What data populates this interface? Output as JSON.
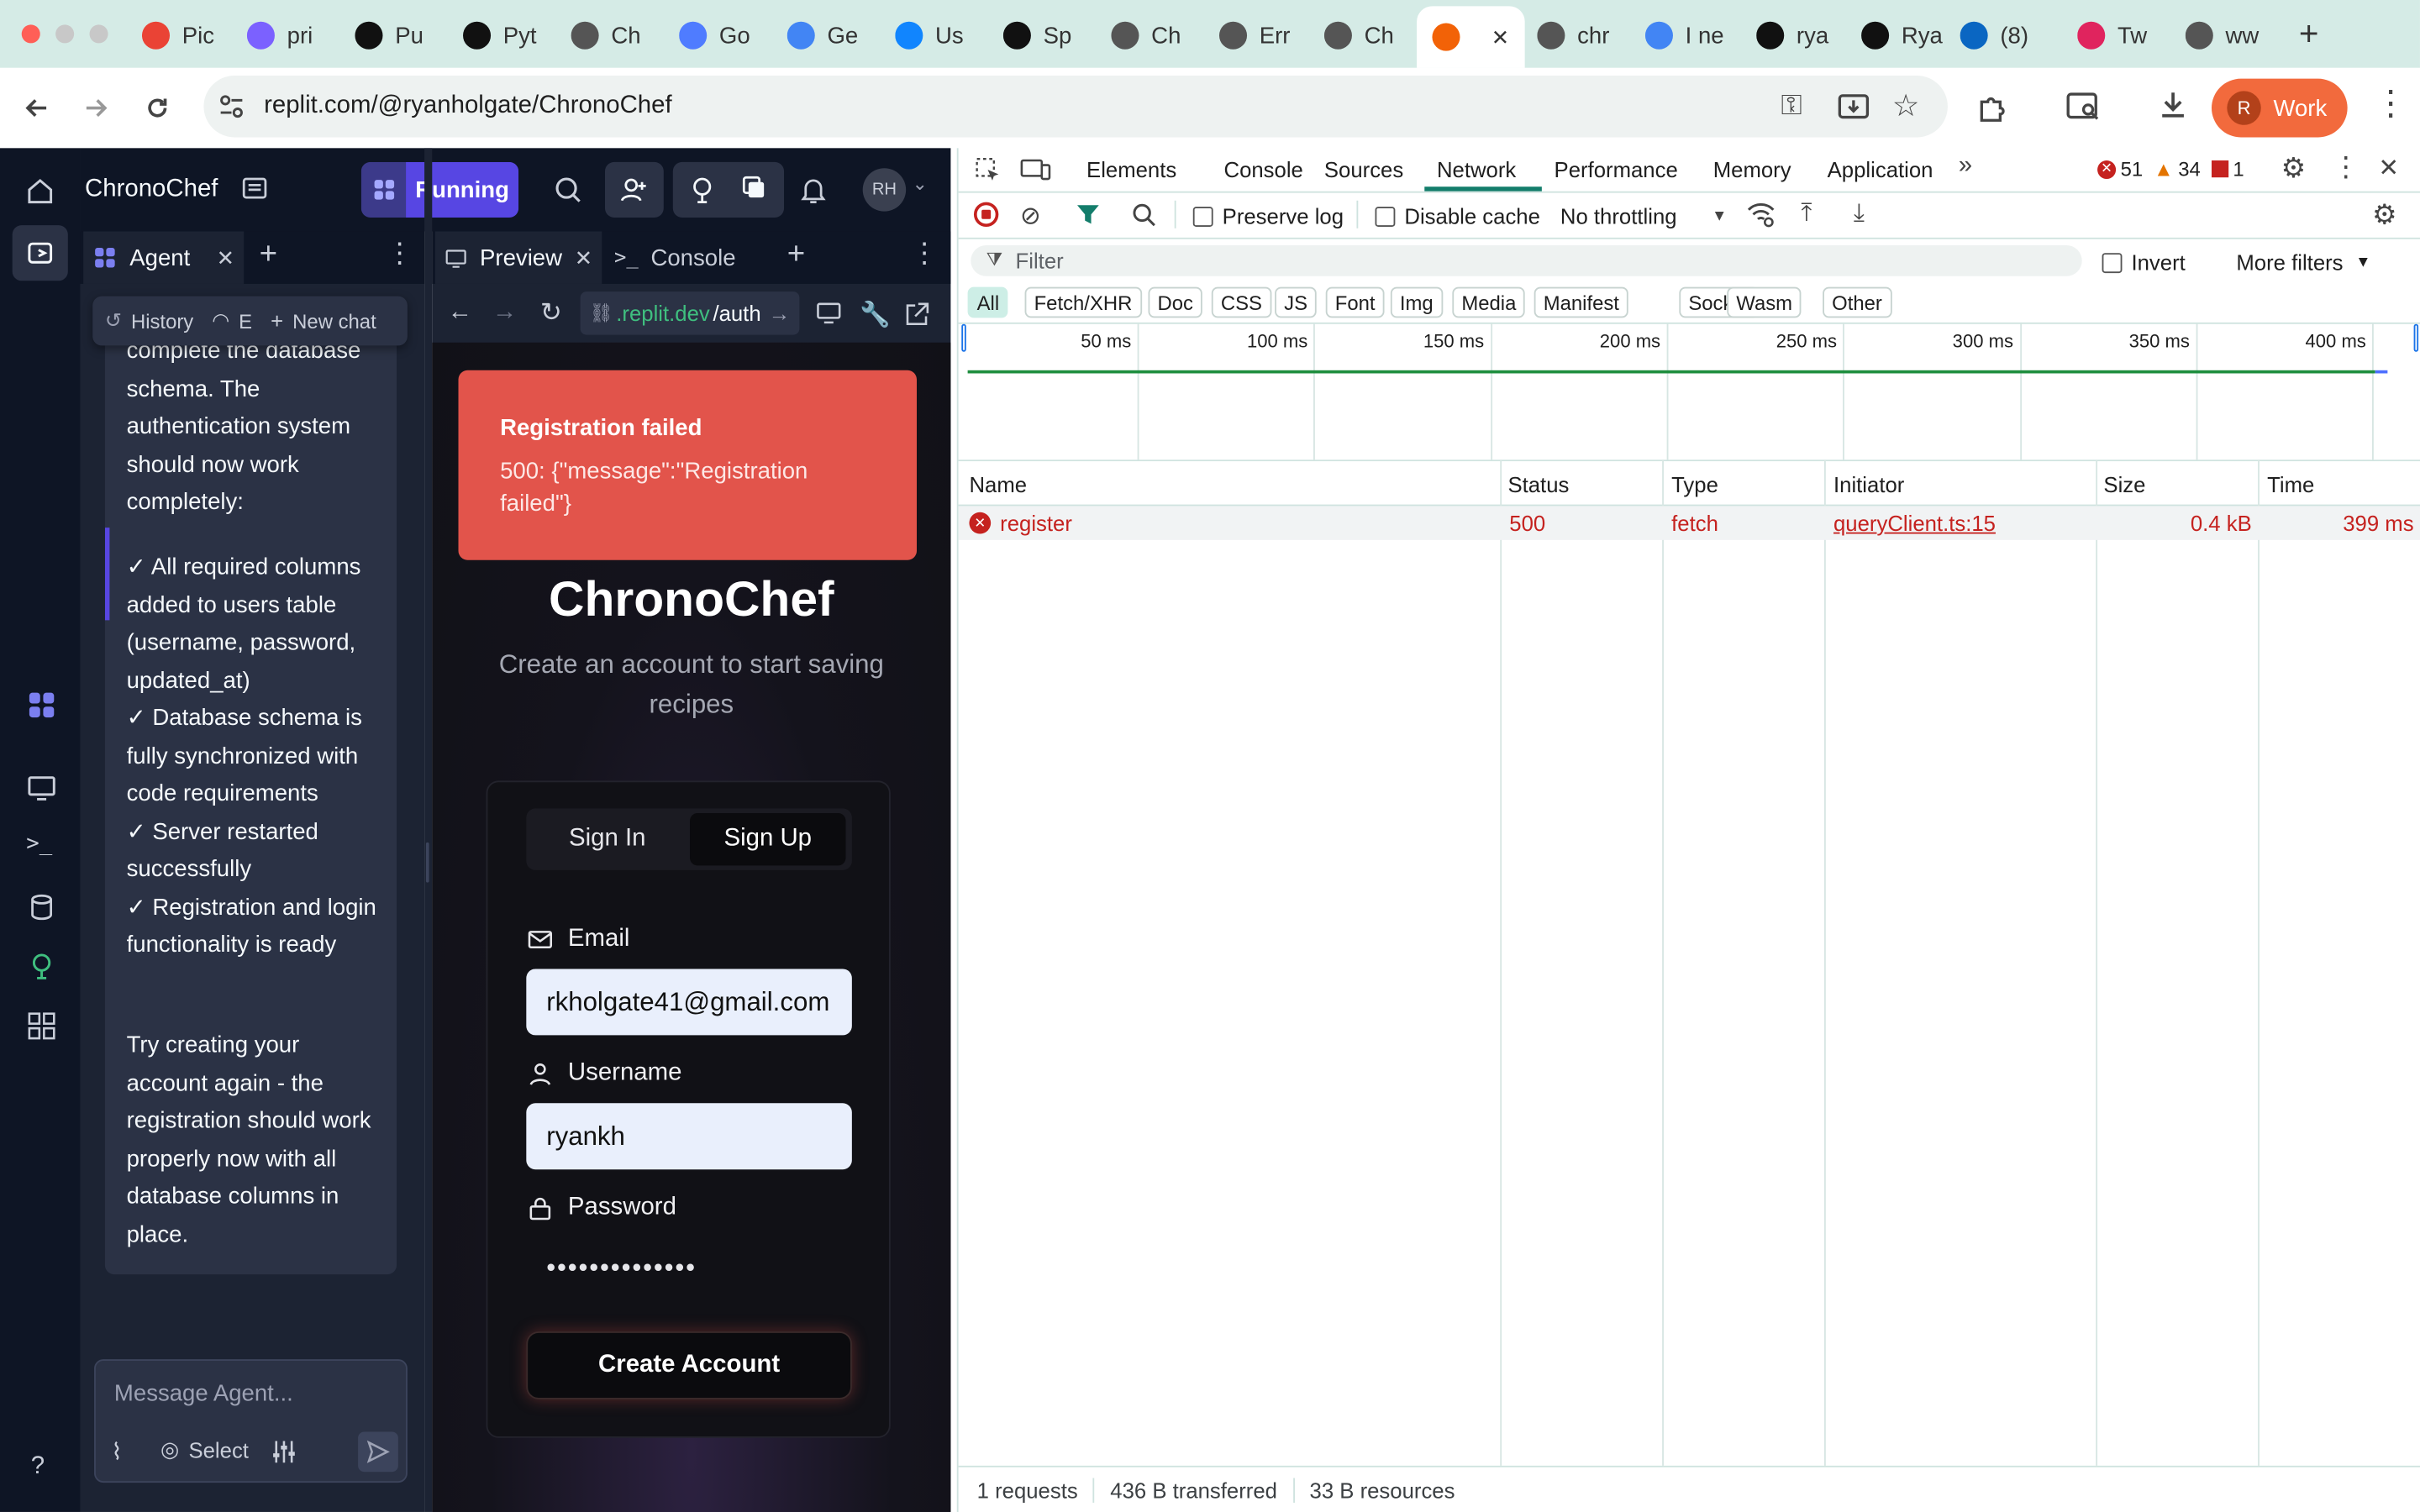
{
  "browser": {
    "tabs": [
      {
        "label": "Pic",
        "icon": "gmail-icon",
        "color": "#ea4335"
      },
      {
        "label": "pri",
        "icon": "vercel-v-icon",
        "color": "#7b61ff"
      },
      {
        "label": "Pu",
        "icon": "perplexity-icon",
        "color": "#111111"
      },
      {
        "label": "Pyt",
        "icon": "openai-icon",
        "color": "#111111"
      },
      {
        "label": "Ch",
        "icon": "globe-icon",
        "color": "#555555"
      },
      {
        "label": "Go",
        "icon": "gemini-icon",
        "color": "#4f7cff"
      },
      {
        "label": "Ge",
        "icon": "google-icon",
        "color": "#4285f4"
      },
      {
        "label": "Us",
        "icon": "bluesky-icon",
        "color": "#1185fe"
      },
      {
        "label": "Sp",
        "icon": "speech-icon",
        "color": "#111111"
      },
      {
        "label": "Ch",
        "icon": "globe-icon",
        "color": "#555555"
      },
      {
        "label": "Err",
        "icon": "globe-icon",
        "color": "#555555"
      },
      {
        "label": "Ch",
        "icon": "globe-icon",
        "color": "#555555"
      },
      {
        "label": "",
        "icon": "replit-icon",
        "color": "#f26207",
        "active": true
      },
      {
        "label": "chr",
        "icon": "globe-icon",
        "color": "#555555"
      },
      {
        "label": "I ne",
        "icon": "google-icon",
        "color": "#4285f4"
      },
      {
        "label": "rya",
        "icon": "github-icon",
        "color": "#111111"
      },
      {
        "label": "Rya",
        "icon": "x-icon",
        "color": "#111111"
      },
      {
        "label": "(8)",
        "icon": "linkedin-icon",
        "color": "#0a66c2"
      },
      {
        "label": "Tw",
        "icon": "twitter-circle-icon",
        "color": "#e0245e"
      },
      {
        "label": "ww",
        "icon": "globe-icon",
        "color": "#555555"
      }
    ],
    "url": "replit.com/@ryanholgate/ChronoChef",
    "profile_initial": "R",
    "profile_label": "Work"
  },
  "replit": {
    "project_name": "ChronoChef",
    "run_label": "Running",
    "user_initials": "RH",
    "agent_tab": "Agent",
    "history_label": "History",
    "checkpoint_label": "E",
    "new_chat_label": "New chat",
    "message_top": "complete the database schema. The authentication system should now work completely:",
    "checks": [
      "✓ All required columns added to users table (username, password, updated_at)",
      "✓ Database schema is fully synchronized with code requirements",
      "✓ Server restarted successfully",
      "✓ Registration and login functionality is ready"
    ],
    "message_bottom": "Try creating your account again - the registration should work properly now with all database columns in place.",
    "input_placeholder": "Message Agent...",
    "select_label": "Select",
    "preview_tab": "Preview",
    "console_tab": "Console",
    "preview_url_prefix": ".replit.dev",
    "preview_url_path": "/auth"
  },
  "app": {
    "toast_title": "Registration failed",
    "toast_message": "500: {\"message\":\"Registration failed\"}",
    "title": "ChronoChef",
    "subtitle": "Create an account to start saving recipes",
    "signin_tab": "Sign In",
    "signup_tab": "Sign Up",
    "email_label": "Email",
    "email_value": "rkholgate41@gmail.com",
    "username_label": "Username",
    "username_value": "ryankh",
    "password_label": "Password",
    "password_mask": "••••••••••••••",
    "create_button": "Create Account"
  },
  "devtools": {
    "panels": [
      "Elements",
      "Console",
      "Sources",
      "Network",
      "Performance",
      "Memory",
      "Application"
    ],
    "active_panel": "Network",
    "errors": "51",
    "warnings": "34",
    "issues": "1",
    "preserve_log": "Preserve log",
    "disable_cache": "Disable cache",
    "throttling": "No throttling",
    "filter_placeholder": "Filter",
    "invert": "Invert",
    "more_filters": "More filters",
    "type_filters": [
      "All",
      "Fetch/XHR",
      "Doc",
      "CSS",
      "JS",
      "Font",
      "Img",
      "Media",
      "Manifest",
      "Socket",
      "Wasm",
      "Other"
    ],
    "timeline_ticks": [
      "50 ms",
      "100 ms",
      "150 ms",
      "200 ms",
      "250 ms",
      "300 ms",
      "350 ms",
      "400 ms"
    ],
    "columns": [
      "Name",
      "Status",
      "Type",
      "Initiator",
      "Size",
      "Time"
    ],
    "rows": [
      {
        "name": "register",
        "status": "500",
        "type": "fetch",
        "initiator": "queryClient.ts:15",
        "size": "0.4 kB",
        "time": "399 ms"
      }
    ],
    "summary": {
      "requests": "1 requests",
      "transferred": "436 B transferred",
      "resources": "33 B resources"
    },
    "colors": {
      "error": "#c5221f",
      "accent": "#0b57d0",
      "active_chip": "#d3e3fd"
    }
  }
}
